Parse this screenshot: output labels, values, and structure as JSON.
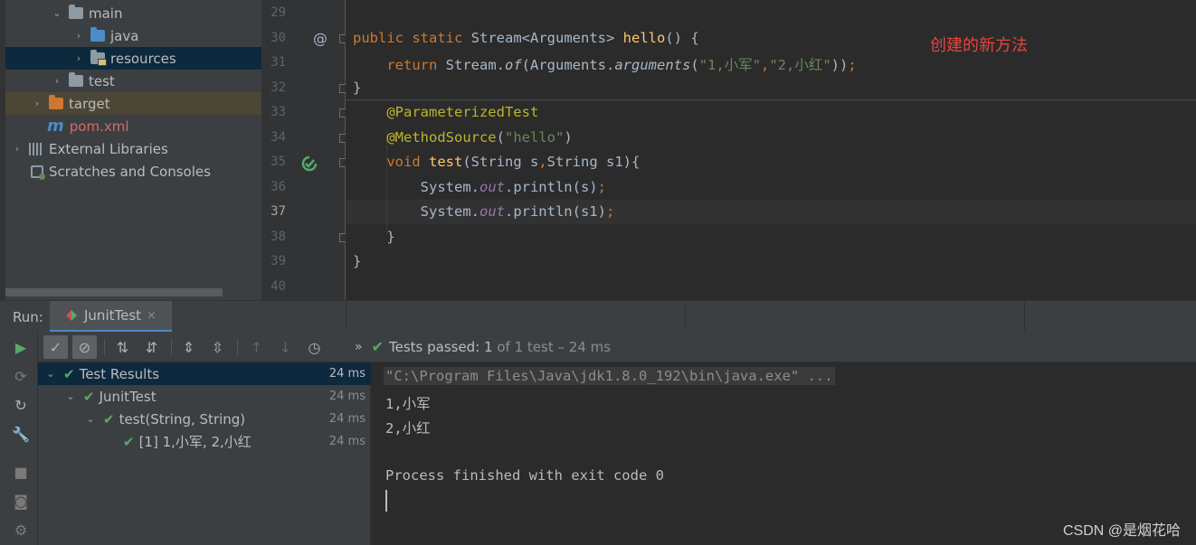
{
  "project_tree": {
    "items": [
      {
        "label": "main"
      },
      {
        "label": "java"
      },
      {
        "label": "resources"
      },
      {
        "label": "test"
      },
      {
        "label": "target"
      },
      {
        "label": "pom.xml"
      },
      {
        "label": "External Libraries"
      },
      {
        "label": "Scratches and Consoles"
      }
    ]
  },
  "editor": {
    "line_numbers": [
      "29",
      "30",
      "31",
      "32",
      "33",
      "34",
      "35",
      "36",
      "37",
      "38",
      "39",
      "40"
    ],
    "current_line": "37",
    "gutter_at_symbol": "@",
    "code": {
      "l30": {
        "kw1": "public",
        "kw2": "static",
        "type": "Stream<Arguments>",
        "name": "hello",
        "rest": "() {"
      },
      "l31": {
        "kw": "return",
        "obj": "Stream.",
        "m1": "of",
        "m2": "(Arguments.",
        "m3": "arguments",
        "p1": "(",
        "s1": "\"1,小军\"",
        "comma": ",",
        "s2": "\"2,小红\"",
        "end": "))",
        "semi": ";"
      },
      "l32": {
        "text": "}"
      },
      "l33": {
        "ann": "@ParameterizedTest"
      },
      "l34": {
        "ann": "@MethodSource",
        "p1": "(",
        "s": "\"hello\"",
        "p2": ")"
      },
      "l35": {
        "kw": "void",
        "name": "test",
        "args": "(String s",
        "comma": ",",
        "args2": "String s1){"
      },
      "l36": {
        "a": "System.",
        "f": "out",
        "b": ".println(s)",
        "semi": ";"
      },
      "l37": {
        "a": "System.",
        "f": "out",
        "b": ".println(s1)",
        "semi": ";"
      },
      "l38": {
        "text": "}"
      },
      "l39": {
        "text": "}"
      }
    },
    "note": "创建的新方法"
  },
  "run_window": {
    "label": "Run:",
    "tab": "JunitTest",
    "tab_close": "×",
    "status": {
      "prefix": "Tests passed:",
      "count": "1",
      "suffix": "of 1 test – 24 ms"
    },
    "results": [
      {
        "label": "Test Results",
        "time": "24 ms"
      },
      {
        "label": "JunitTest",
        "time": "24 ms"
      },
      {
        "label": "test(String, String)",
        "time": "24 ms"
      },
      {
        "label": "[1] 1,小军, 2,小红",
        "time": "24 ms"
      }
    ],
    "console": {
      "command": "\"C:\\Program Files\\Java\\jdk1.8.0_192\\bin\\java.exe\" ...",
      "lines": [
        "1,小军",
        "2,小红",
        "",
        "Process finished with exit code 0"
      ]
    }
  },
  "watermark": "CSDN @是烟花哈",
  "colors": {
    "keyword": "#cc7832",
    "function": "#ffc66d",
    "string": "#6a8759",
    "annotation": "#bbb529",
    "static_field": "#9876aa",
    "pass": "#59a869",
    "note": "#e8443a"
  }
}
